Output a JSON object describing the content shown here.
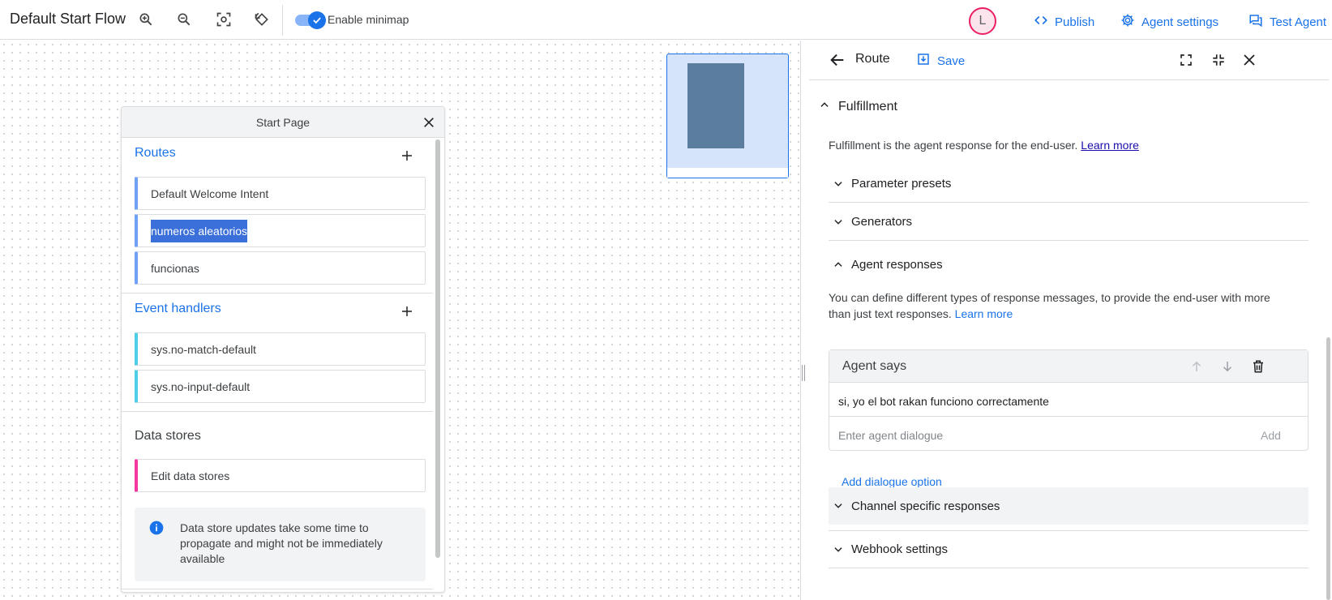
{
  "topbar": {
    "title": "Default Start Flow",
    "minimap_label": "Enable minimap",
    "minimap_enabled": true,
    "avatar_initial": "L",
    "publish": "Publish",
    "agent_settings": "Agent settings",
    "test_agent": "Test Agent"
  },
  "card": {
    "title": "Start Page",
    "routes_header": "Routes",
    "routes": [
      "Default Welcome Intent",
      "numeros aleatorios",
      "funcionas"
    ],
    "event_handlers_header": "Event handlers",
    "event_handlers": [
      "sys.no-match-default",
      "sys.no-input-default"
    ],
    "data_stores_header": "Data stores",
    "data_store_item": "Edit data stores",
    "info": "Data store updates take some time to propagate and might not be immediately available"
  },
  "panel": {
    "title": "Route",
    "save": "Save",
    "fulfillment": "Fulfillment",
    "fulfillment_desc": "Fulfillment is the agent response for the end-user.",
    "learn_more": "Learn more",
    "parameter_presets": "Parameter presets",
    "generators": "Generators",
    "agent_responses": "Agent responses",
    "agent_responses_desc_1": "You can define different types of response messages, to provide the end-user with more",
    "agent_responses_desc_2": "than just text responses.",
    "agent_says": {
      "title": "Agent says",
      "text": "si, yo el bot rakan funciono correctamente",
      "placeholder": "Enter agent dialogue",
      "add": "Add"
    },
    "add_dialogue_option": "Add dialogue option",
    "channel_specific": "Channel specific responses",
    "webhook_settings": "Webhook settings"
  },
  "colors": {
    "accent": "#1a73e8",
    "route_bar": "#6fa2f5",
    "event_bar": "#4ecde6",
    "data_store_bar": "#f538a0",
    "selection": "#3b6fd9"
  }
}
